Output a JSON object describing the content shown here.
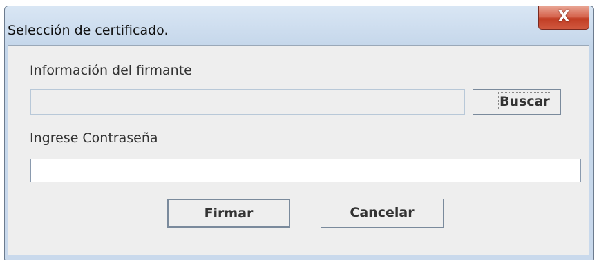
{
  "window": {
    "title": "Selección de certificado.",
    "close_glyph": "X"
  },
  "form": {
    "signer_info_label": "Información del firmante",
    "signer_info_value": "",
    "search_button": "Buscar",
    "password_label": "Ingrese Contraseña",
    "password_value": ""
  },
  "actions": {
    "sign_button": "Firmar",
    "cancel_button": "Cancelar"
  },
  "icons": {
    "close": "close-icon"
  }
}
